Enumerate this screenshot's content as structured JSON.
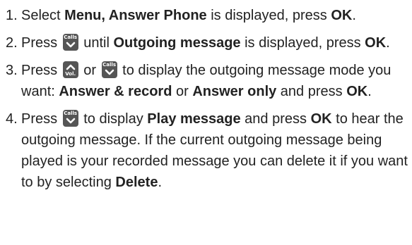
{
  "steps": [
    {
      "number": "1.",
      "parts": [
        {
          "text": "Select "
        },
        {
          "text": "Menu, Answer Phone",
          "bold": true
        },
        {
          "text": " is displayed, press "
        },
        {
          "text": "OK",
          "bold": true
        },
        {
          "text": "."
        }
      ]
    },
    {
      "number": "2.",
      "parts": [
        {
          "text": "Press "
        },
        {
          "key": "calls-down"
        },
        {
          "text": " until "
        },
        {
          "text": "Outgoing message",
          "bold": true
        },
        {
          "text": " is displayed, press "
        },
        {
          "text": "OK",
          "bold": true
        },
        {
          "text": "."
        }
      ]
    },
    {
      "number": "3.",
      "parts": [
        {
          "text": "Press "
        },
        {
          "key": "vol-up"
        },
        {
          "text": " or "
        },
        {
          "key": "calls-down"
        },
        {
          "text": " to display the outgoing message mode you want: "
        },
        {
          "text": "Answer & record",
          "bold": true
        },
        {
          "text": " or "
        },
        {
          "text": "Answer only",
          "bold": true
        },
        {
          "text": " and press "
        },
        {
          "text": "OK",
          "bold": true
        },
        {
          "text": "."
        }
      ]
    },
    {
      "number": "4.",
      "parts": [
        {
          "text": "Press "
        },
        {
          "key": "calls-down"
        },
        {
          "text": " to display "
        },
        {
          "text": "Play message",
          "bold": true
        },
        {
          "text": " and press "
        },
        {
          "text": "OK",
          "bold": true
        },
        {
          "text": " to hear the outgoing message. If the current outgoing message being played is your recorded message you can delete it if you want to by selecting "
        },
        {
          "text": "Delete",
          "bold": true
        },
        {
          "text": "."
        }
      ]
    }
  ],
  "keys": {
    "calls-down": {
      "label": "Calls",
      "icon": "chevron-down-icon",
      "color": "#555555"
    },
    "vol-up": {
      "label": "Vol.",
      "icon": "chevron-up-icon",
      "color": "#555555"
    }
  }
}
